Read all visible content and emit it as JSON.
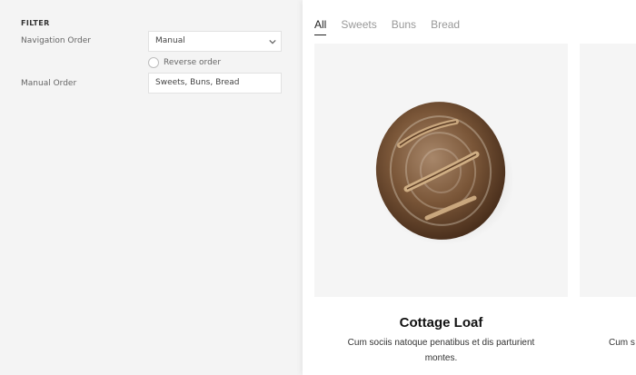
{
  "filter": {
    "section_title": "FILTER",
    "navigation_order": {
      "label": "Navigation Order",
      "value": "Manual"
    },
    "reverse_order": {
      "label": "Reverse order",
      "checked": false
    },
    "manual_order": {
      "label": "Manual Order",
      "value": "Sweets, Buns, Bread"
    }
  },
  "preview": {
    "tabs": [
      {
        "label": "All",
        "active": true
      },
      {
        "label": "Sweets",
        "active": false
      },
      {
        "label": "Buns",
        "active": false
      },
      {
        "label": "Bread",
        "active": false
      }
    ],
    "cards": [
      {
        "title": "Cottage Loaf",
        "description": "Cum sociis natoque penatibus et dis parturient montes.",
        "image": "bread-loaf"
      },
      {
        "title": "",
        "description": "Cum s",
        "image": "placeholder"
      }
    ]
  }
}
